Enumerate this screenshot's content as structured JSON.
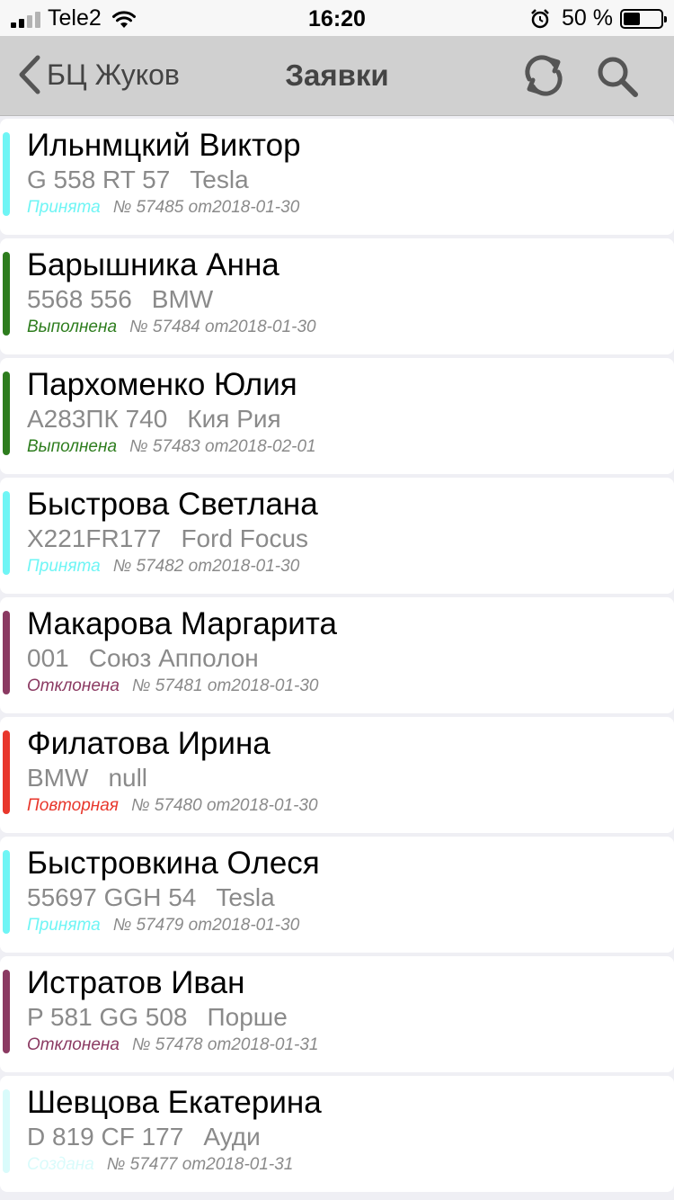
{
  "status_bar": {
    "carrier": "Tele2",
    "time": "16:20",
    "battery": "50 %",
    "battery_level": 0.5
  },
  "nav": {
    "back_label": "БЦ Жуков",
    "title": "Заявки",
    "refresh_icon": "refresh-icon",
    "search_icon": "search-icon"
  },
  "status_colors": {
    "Принята": "#6ff5f5",
    "Выполнена": "#2e7d1e",
    "Отклонена": "#8b3a62",
    "Повторная": "#e8372c",
    "Создана": "#d9fbfb"
  },
  "requests": [
    {
      "name": "Ильнмцкий Виктор",
      "plate": "G 558 RT 57",
      "model": "Tesla",
      "status": "Принята",
      "number": "№ 57485",
      "date": "от2018-01-30"
    },
    {
      "name": "Барышника Анна",
      "plate": "5568 556",
      "model": "BMW",
      "status": "Выполнена",
      "number": "№ 57484",
      "date": "от2018-01-30"
    },
    {
      "name": "Пархоменко Юлия",
      "plate": "А283ПК 740",
      "model": "Кия Рия",
      "status": "Выполнена",
      "number": "№ 57483",
      "date": "от2018-02-01"
    },
    {
      "name": "Быстрова Светлана",
      "plate": "X221FR177",
      "model": "Ford Focus",
      "status": "Принята",
      "number": "№ 57482",
      "date": "от2018-01-30"
    },
    {
      "name": "Макарова Маргарита",
      "plate": "001",
      "model": "Союз Апполон",
      "status": "Отклонена",
      "number": "№ 57481",
      "date": "от2018-01-30"
    },
    {
      "name": "Филатова Ирина",
      "plate": "BMW",
      "model": "null",
      "status": "Повторная",
      "number": "№ 57480",
      "date": "от2018-01-30"
    },
    {
      "name": "Быстровкина Олеся",
      "plate": "55697 GGH 54",
      "model": "Tesla",
      "status": "Принята",
      "number": "№ 57479",
      "date": "от2018-01-30"
    },
    {
      "name": "Истратов Иван",
      "plate": "P 581 GG 508",
      "model": "Порше",
      "status": "Отклонена",
      "number": "№ 57478",
      "date": "от2018-01-31"
    },
    {
      "name": "Шевцова Екатерина",
      "plate": "D 819 CF 177",
      "model": "Ауди",
      "status": "Создана",
      "number": "№ 57477",
      "date": "от2018-01-31"
    }
  ]
}
